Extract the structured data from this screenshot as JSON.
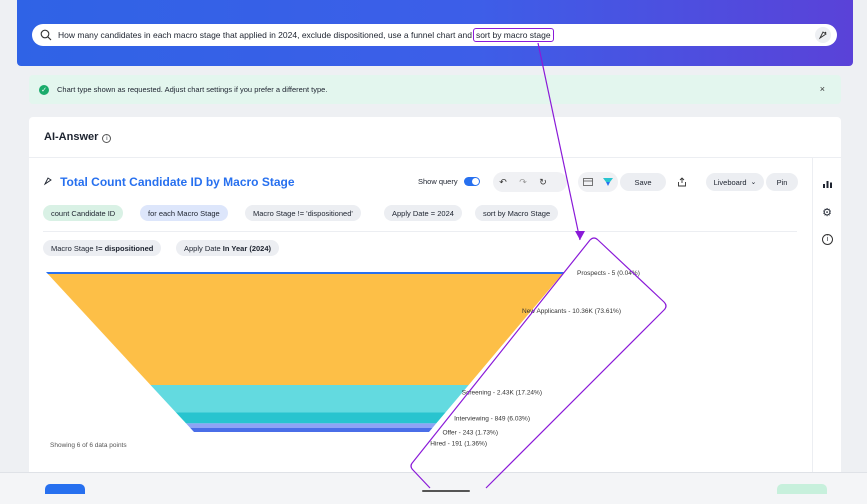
{
  "search": {
    "query_prefix": "How many candidates in each macro stage that applied in 2024, exclude dispositioned, use a funnel chart and ",
    "query_highlight": "sort by macro stage"
  },
  "banner": {
    "message": "Chart type shown as requested. Adjust chart settings if you prefer a different type.",
    "close": "×"
  },
  "card": {
    "title": "AI-Answer",
    "info_icon": "i"
  },
  "viz": {
    "title": "Total Count Candidate ID by Macro Stage",
    "show_query": "Show query",
    "save": "Save",
    "liveboard": "Liveboard",
    "pin": "Pin",
    "data_points": "Showing 6 of 6 data points"
  },
  "tokens": [
    "count Candidate ID",
    "for each Macro Stage",
    "Macro Stage != 'dispositioned'",
    "Apply Date = 2024",
    "sort by Macro Stage"
  ],
  "filters": {
    "f1_label": "Macro Stage ",
    "f1_value": "!= dispositioned",
    "f2_label": "Apply Date ",
    "f2_value": "In Year (2024)"
  },
  "icons": {
    "search": "search-icon",
    "rocket": "sage-icon",
    "check": "check-circle-icon",
    "close": "close-icon",
    "undo": "undo-icon",
    "redo": "redo-icon",
    "reset": "reset-icon",
    "table": "table-icon",
    "chart": "funnel-icon",
    "download": "download-icon",
    "chevron": "chevron-down-icon",
    "chart_settings": "bar-chart-icon",
    "gear": "gear-icon",
    "info": "info-icon"
  },
  "colors": {
    "accent": "#2770ef",
    "highlight": "#8a1ad8",
    "prospects": "#2770ef",
    "new_applicants": "#fdbf47",
    "screening": "#63dae0",
    "interviewing": "#28c4cf",
    "offer": "#8ea3f5",
    "hired": "#4a6ee8"
  },
  "chart_data": {
    "type": "funnel",
    "categories": [
      "Prospects",
      "New Applicants",
      "Screening",
      "Interviewing",
      "Offer",
      "Hired"
    ],
    "values": [
      5,
      10360,
      2430,
      849,
      243,
      191
    ],
    "labels": [
      "Prospects - 5 (0.04%)",
      "New Applicants - 10.36K (73.61%)",
      "Screening - 2.43K (17.24%)",
      "Interviewing - 849 (6.03%)",
      "Offer - 243 (1.73%)",
      "Hired - 191 (1.36%)"
    ],
    "percents": [
      0.04,
      73.61,
      17.24,
      6.03,
      1.73,
      1.36
    ]
  }
}
